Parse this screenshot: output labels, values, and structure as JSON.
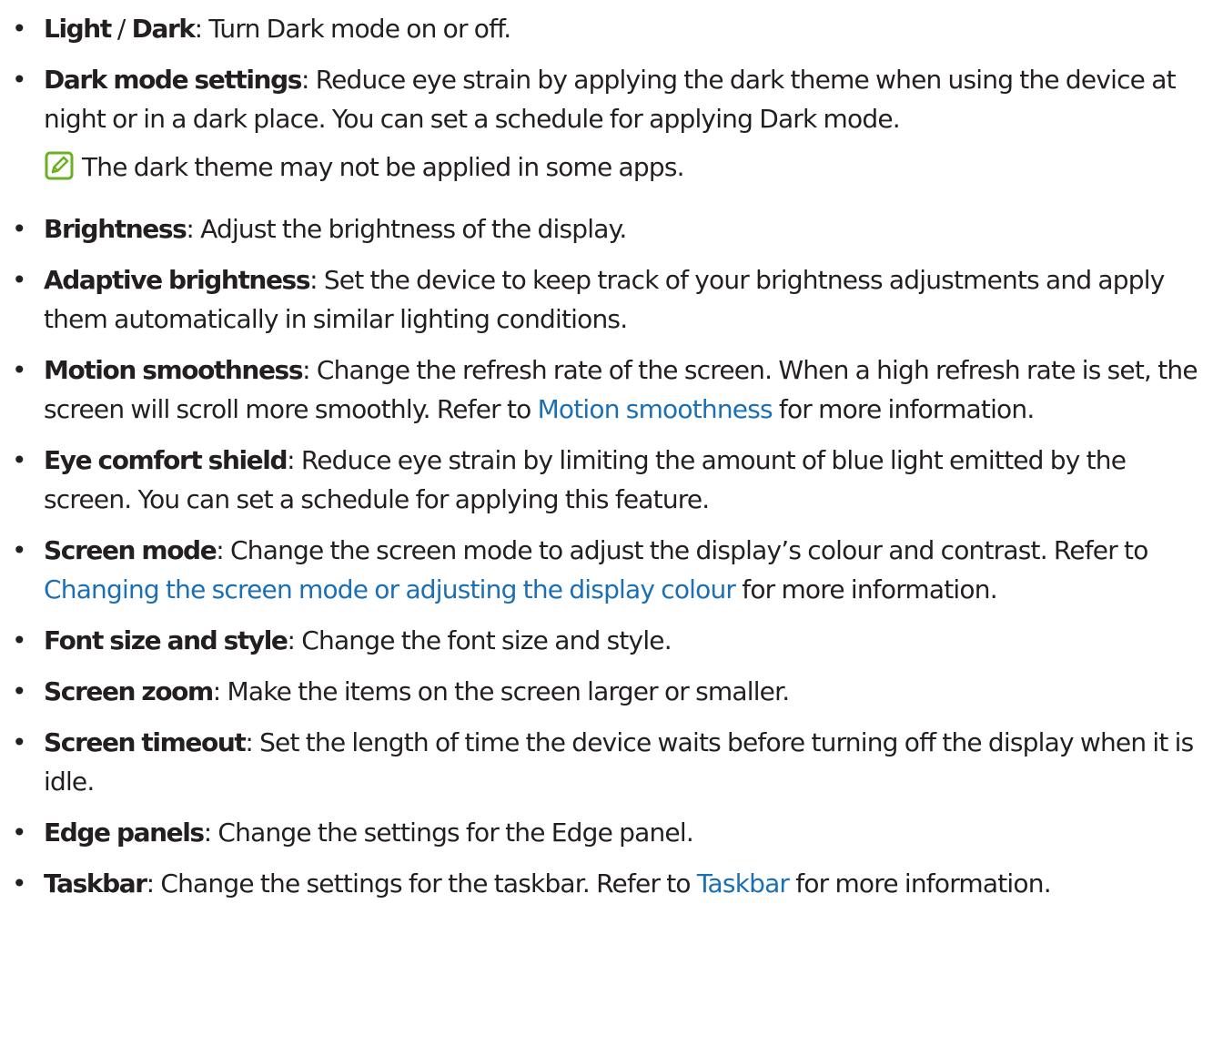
{
  "items_before_note": [
    {
      "term1": "Light",
      "sep": " / ",
      "term2": "Dark",
      "desc": ": Turn Dark mode on or off."
    },
    {
      "term": "Dark mode settings",
      "desc": ": Reduce eye strain by applying the dark theme when using the device at night or in a dark place. You can set a schedule for applying Dark mode."
    }
  ],
  "note": {
    "icon": "note-pencil-icon",
    "icon_color": "#6ab023",
    "text": "The dark theme may not be applied in some apps."
  },
  "items": {
    "brightness": {
      "term": "Brightness",
      "desc": ": Adjust the brightness of the display."
    },
    "adaptive_brightness": {
      "term": "Adaptive brightness",
      "desc": ": Set the device to keep track of your brightness adjustments and apply them automatically in similar lighting conditions."
    },
    "motion_smoothness": {
      "term": "Motion smoothness",
      "desc_before": ": Change the refresh rate of the screen. When a high refresh rate is set, the screen will scroll more smoothly. Refer to ",
      "link": "Motion smoothness",
      "desc_after": " for more information."
    },
    "eye_comfort": {
      "term": "Eye comfort shield",
      "desc": ": Reduce eye strain by limiting the amount of blue light emitted by the screen. You can set a schedule for applying this feature."
    },
    "screen_mode": {
      "term": "Screen mode",
      "desc_before": ": Change the screen mode to adjust the display’s colour and contrast. Refer to ",
      "link": "Changing the screen mode or adjusting the display colour",
      "desc_after": " for more information."
    },
    "font_size": {
      "term": "Font size and style",
      "desc": ": Change the font size and style."
    },
    "screen_zoom": {
      "term": "Screen zoom",
      "desc": ": Make the items on the screen larger or smaller."
    },
    "screen_timeout": {
      "term": "Screen timeout",
      "desc": ": Set the length of time the device waits before turning off the display when it is idle."
    },
    "edge_panels": {
      "term": "Edge panels",
      "desc": ": Change the settings for the Edge panel."
    },
    "taskbar": {
      "term": "Taskbar",
      "desc_before": ": Change the settings for the taskbar. Refer to ",
      "link": "Taskbar",
      "desc_after": " for more information."
    }
  },
  "bullet": "•",
  "link_color": "#1a6fb5"
}
